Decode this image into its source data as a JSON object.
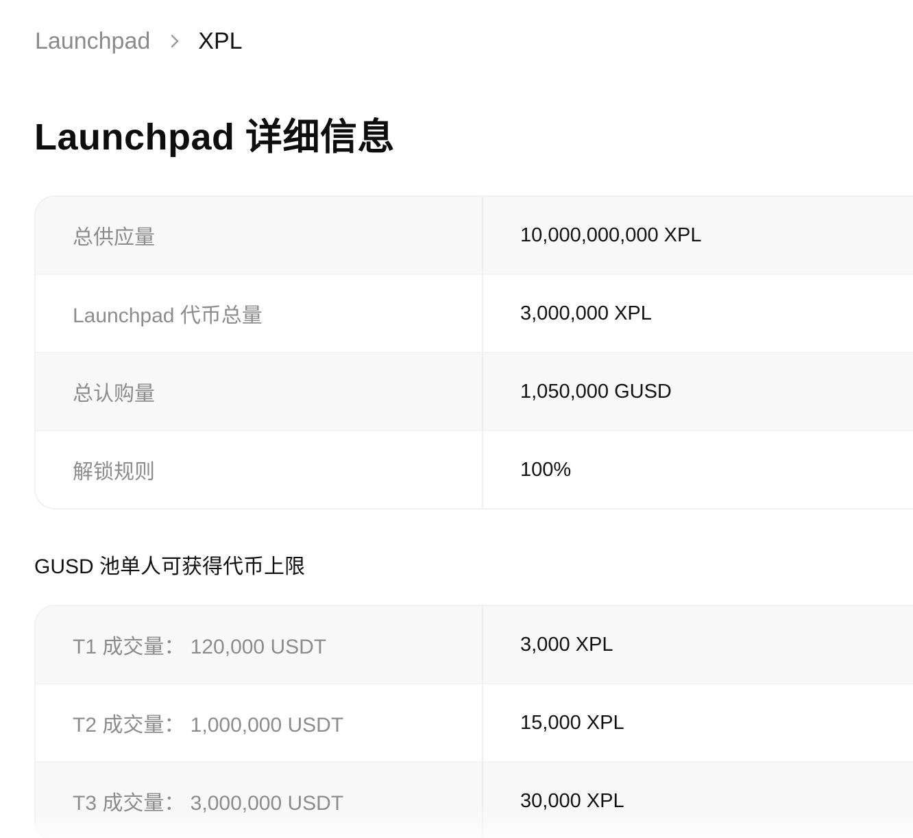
{
  "breadcrumb": {
    "parent": "Launchpad",
    "separator_icon": "chevron-right-icon",
    "current": "XPL"
  },
  "title": "Launchpad 详细信息",
  "details": [
    {
      "label": "总供应量",
      "value": "10,000,000,000 XPL"
    },
    {
      "label": "Launchpad 代币总量",
      "value": "3,000,000 XPL"
    },
    {
      "label": "总认购量",
      "value": "1,050,000 GUSD"
    },
    {
      "label": "解锁规则",
      "value": "100%"
    }
  ],
  "pool_section": {
    "title": "GUSD 池单人可获得代币上限",
    "tiers": [
      {
        "label": "T1 成交量： 120,000 USDT",
        "value": "3,000 XPL"
      },
      {
        "label": "T2 成交量： 1,000,000 USDT",
        "value": "15,000 XPL"
      },
      {
        "label": "T3 成交量： 3,000,000 USDT",
        "value": "30,000 XPL"
      }
    ]
  },
  "colors": {
    "muted_text": "#8c8c8c",
    "primary_text": "#111111",
    "row_shade": "#f8f8f8",
    "border": "#efefef"
  }
}
